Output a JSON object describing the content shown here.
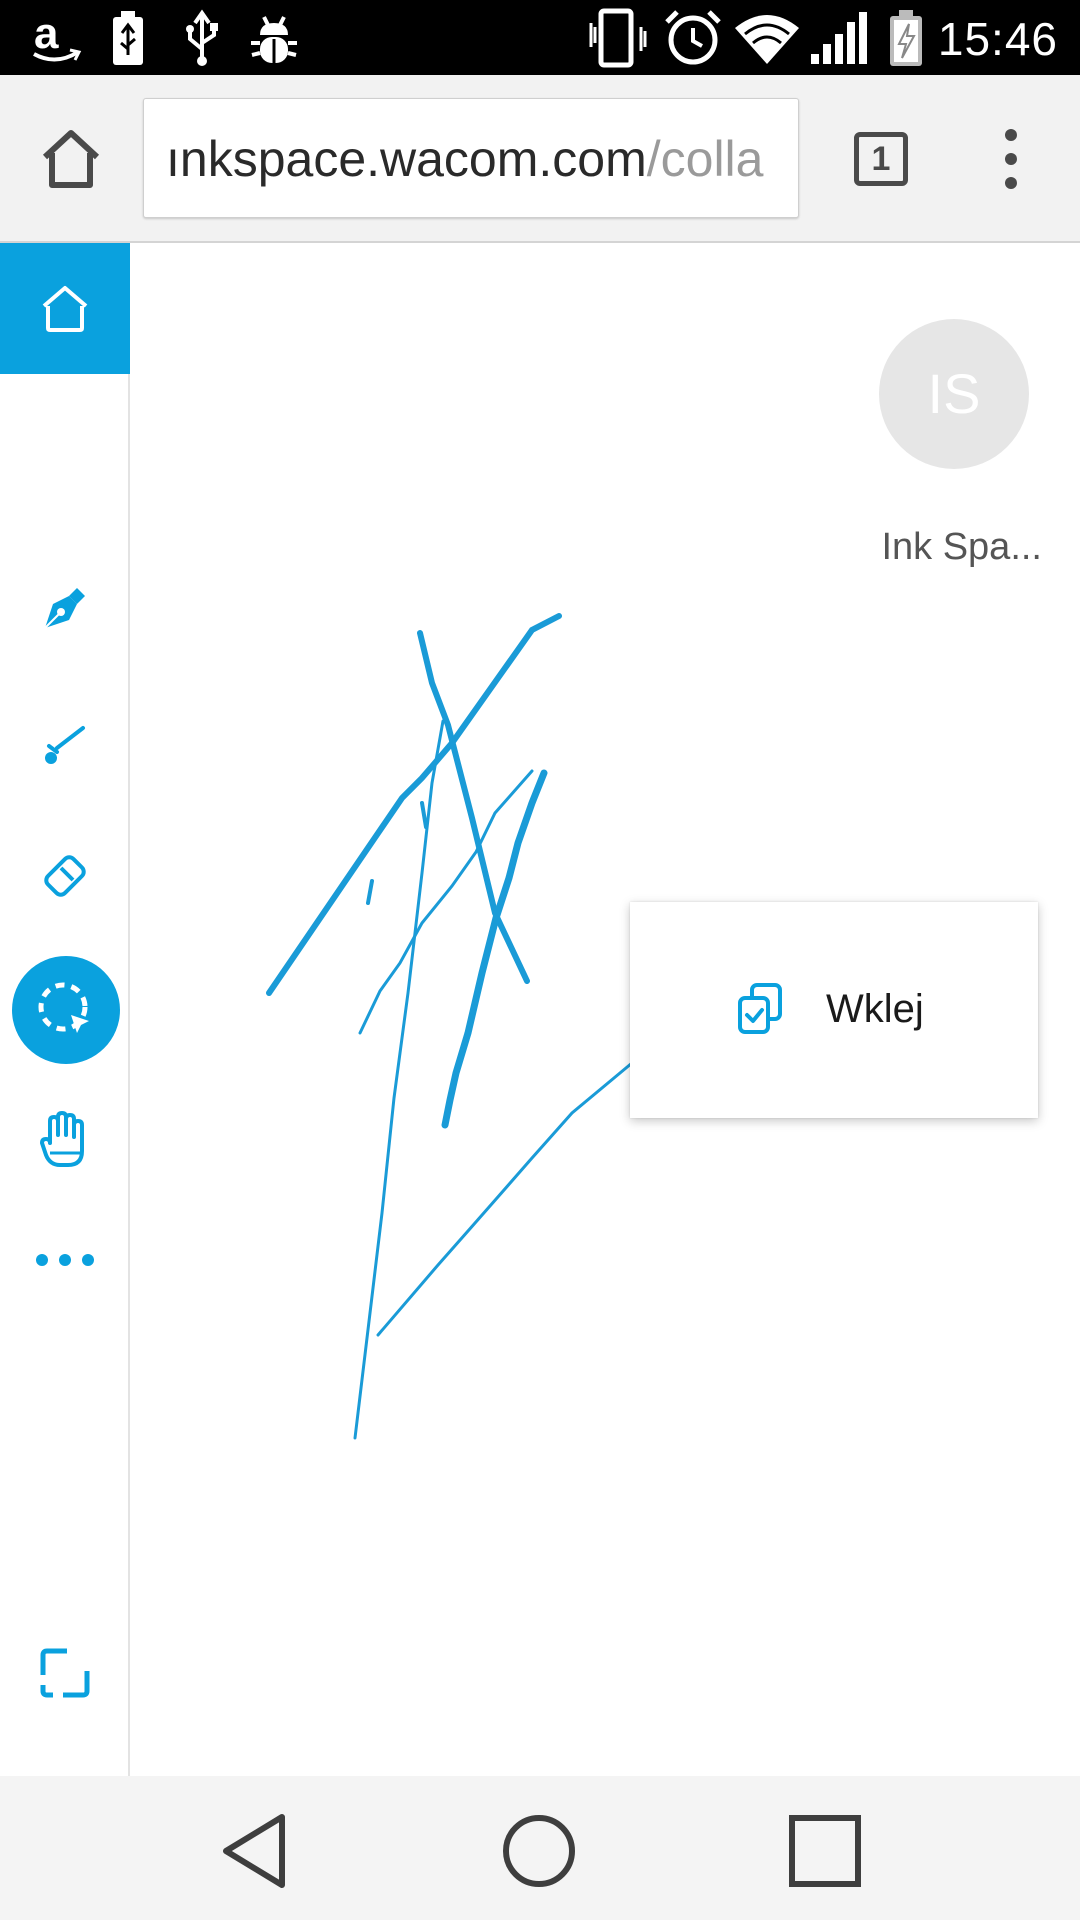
{
  "status_bar": {
    "time": "15:46",
    "left_icons": [
      "amazon-icon",
      "battery-usb-icon",
      "usb-icon",
      "debug-bug-icon"
    ],
    "right_icons": [
      "vibrate-icon",
      "alarm-icon",
      "wifi-icon",
      "signal-icon",
      "battery-charging-icon"
    ]
  },
  "browser": {
    "url_host": "ınkspace.wacom.com",
    "url_path": "/colla",
    "tab_count": "1"
  },
  "sidebar": {
    "items": [
      "home-icon",
      "pen-icon",
      "brush-icon",
      "eraser-icon",
      "lasso-select-icon",
      "hand-icon",
      "more-icon",
      "fullscreen-icon"
    ],
    "active_tool": "lasso-select"
  },
  "canvas": {
    "avatar_initials": "IS",
    "avatar_name": "Ink Spa...",
    "stroke_color": "#1a9bd7"
  },
  "context_menu": {
    "paste_label": "Wklej"
  },
  "colors": {
    "accent": "#0aa1de",
    "status_bar_bg": "#000000",
    "toolbar_bg": "#f2f2f2"
  }
}
